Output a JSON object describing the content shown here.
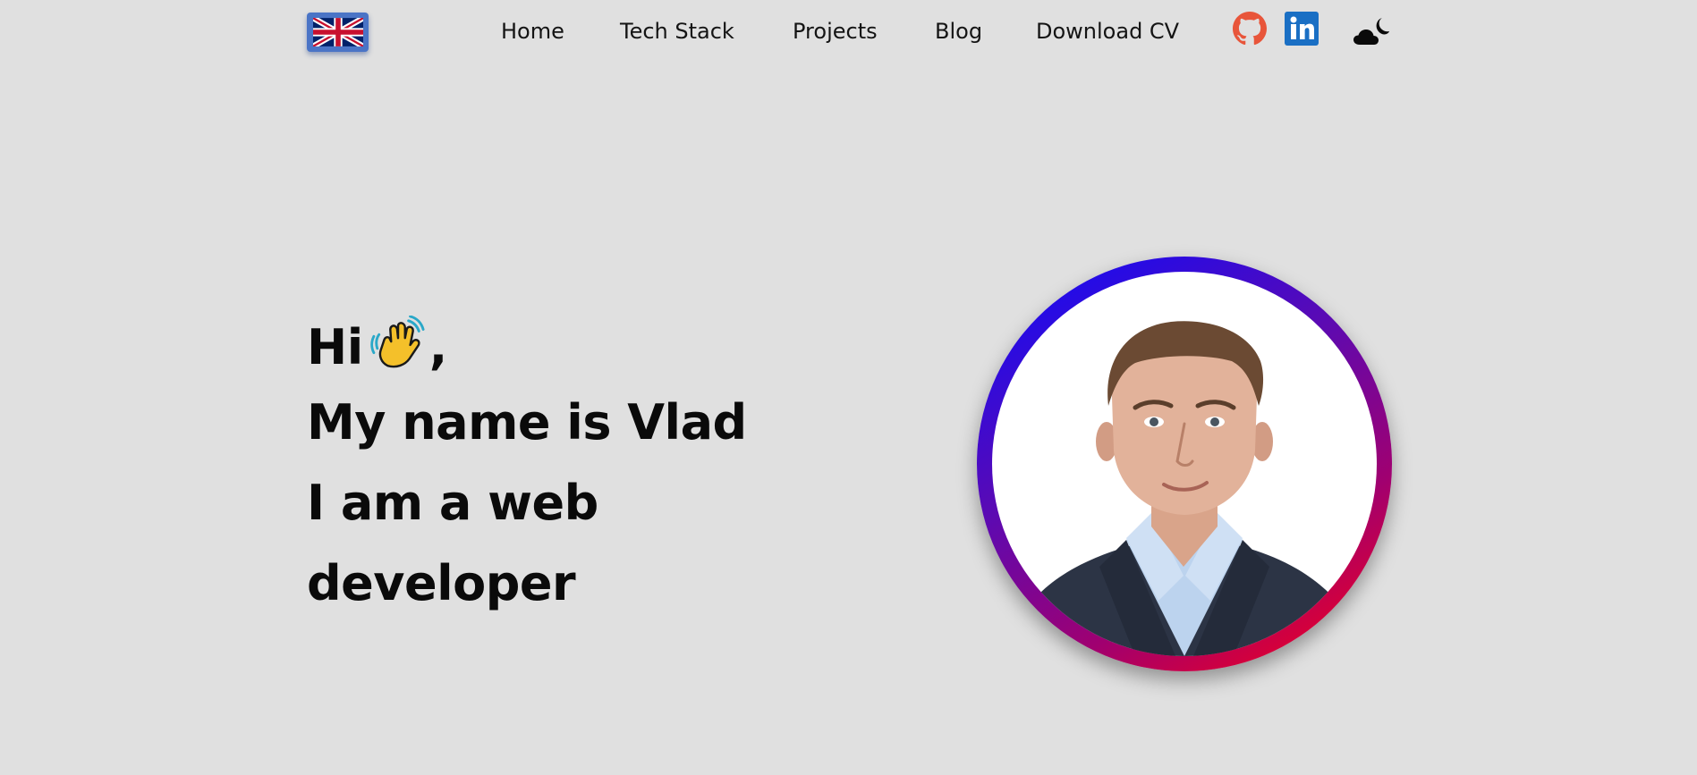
{
  "header": {
    "language": {
      "icon": "uk-flag-icon",
      "accent_color": "#4a74c6"
    },
    "nav": [
      {
        "label": "Home"
      },
      {
        "label": "Tech Stack"
      },
      {
        "label": "Projects"
      },
      {
        "label": "Blog"
      },
      {
        "label": "Download CV"
      }
    ],
    "social": [
      {
        "icon": "github-icon",
        "color": "#e8553a"
      },
      {
        "icon": "linkedin-icon",
        "color": "#1a6fc4"
      }
    ],
    "theme_toggle": {
      "icon": "moon-cloud-icon"
    }
  },
  "hero": {
    "greeting": "Hi",
    "greeting_emoji": "waving-hand-icon",
    "greeting_suffix": ",",
    "line2": "My name is Vlad",
    "line3": "I am a web",
    "line4": "developer",
    "portrait": {
      "icon": "profile-photo",
      "ring_colors": [
        "#0a0cff",
        "#ff0010"
      ]
    }
  }
}
